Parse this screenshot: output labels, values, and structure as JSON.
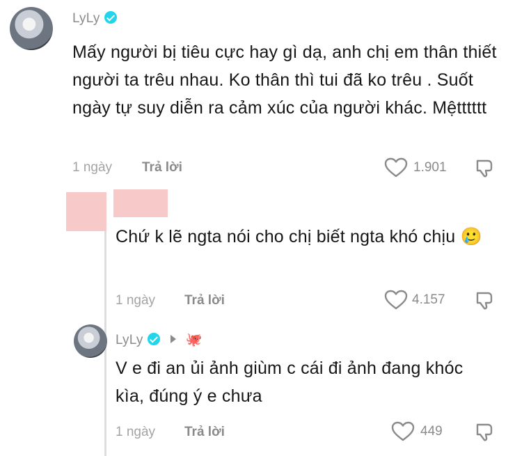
{
  "comments": [
    {
      "username": "LyLy",
      "text": "Mấy người bị tiêu cực hay gì dạ, anh chị em thân thiết người ta trêu nhau. Ko thân thì tui đã ko trêu . Suốt ngày tự suy diễn ra cảm xúc của người khác. Mệtttttt",
      "time": "1 ngày",
      "reply_label": "Trả lời",
      "likes": "1.901"
    },
    {
      "username": "",
      "text": "Chứ k lẽ ngta nói cho chị biết ngta khó chịu 🥲",
      "time": "1 ngày",
      "reply_label": "Trả lời",
      "likes": "4.157"
    },
    {
      "username": "LyLy",
      "reply_to_emoji": "🐙",
      "text": "V e đi an ủi ảnh giùm c cái đi ảnh đang khóc kìa, đúng ý e chưa",
      "time": "1 ngày",
      "reply_label": "Trả lời",
      "likes": "449"
    }
  ],
  "icons": {
    "verified": "verified-badge-icon",
    "like": "heart-icon",
    "dislike": "thumbs-down-icon",
    "arrow": "play-arrow-icon"
  },
  "colors": {
    "verified": "#20d5ec",
    "redaction": "#f7c9c9",
    "meta": "#a3a3a3"
  }
}
